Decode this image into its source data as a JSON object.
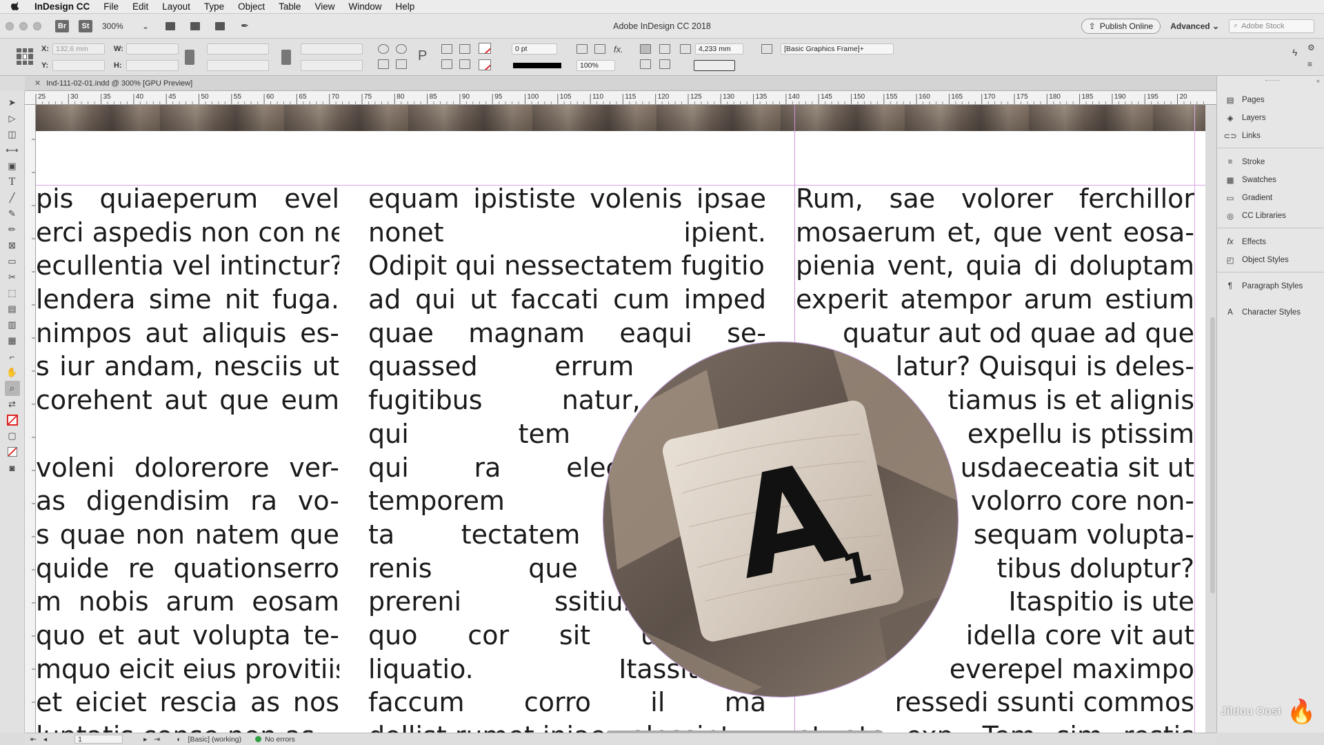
{
  "menubar": {
    "app": "InDesign CC",
    "items": [
      "File",
      "Edit",
      "Layout",
      "Type",
      "Object",
      "Table",
      "View",
      "Window",
      "Help"
    ]
  },
  "appbar": {
    "title": "Adobe InDesign CC 2018",
    "bridge_badge": "Br",
    "stock_badge": "St",
    "zoom": "300%",
    "publish_label": "Publish Online",
    "workspace": "Advanced",
    "search_placeholder": "Adobe Stock"
  },
  "control": {
    "x_label": "X:",
    "y_label": "Y:",
    "w_label": "W:",
    "h_label": "H:",
    "x_value": "132,6 mm",
    "stroke_weight": "0 pt",
    "opacity": "100%",
    "gutter": "4,233 mm",
    "object_style": "[Basic Graphics Frame]+"
  },
  "document_tab": {
    "label": "Ind-111-02-01.indd @ 300% [GPU Preview]"
  },
  "ruler": {
    "labels": [
      "25",
      "30",
      "35",
      "40",
      "45",
      "50",
      "55",
      "60",
      "65",
      "70",
      "75",
      "80",
      "85",
      "90",
      "95",
      "100",
      "105",
      "110",
      "115",
      "120",
      "125",
      "130",
      "135",
      "140",
      "145",
      "150",
      "155",
      "160",
      "165",
      "170",
      "175",
      "180",
      "185",
      "190",
      "195",
      "20"
    ]
  },
  "text": {
    "col1": [
      "pis quiaeperum evel",
      "erci aspedis non con ne",
      "ecullentia vel intinctur?",
      "lendera sime nit fuga.",
      "nimpos aut aliquis es-",
      "s iur andam, nesciis ut",
      "corehent aut que eum",
      "",
      "voleni dolorerore ver-",
      "as digendisim ra vo-",
      "s quae non natem que",
      "quide re quationserro",
      "m nobis arum eosam",
      "quo et aut volupta te-",
      "mquo eicit eius provitiis",
      "et eiciet rescia as nos",
      "luptatis conse non as"
    ],
    "col2": [
      "equam ipististe volenis ipsae",
      "nonet ipient.",
      "Odipit qui nessectatem fugitios",
      "ad qui ut faccati cum imped",
      "quae magnam eaqui se-",
      "quassed errum sam",
      "fugitibus natur, nos",
      "qui tem conse-",
      "qui ra elecea est,",
      "temporem illup-",
      "ta tectatem et et",
      "renis que veriate",
      "prereni ssitiur se-",
      "quo cor sit ut vel-",
      "liquatio. Itassitatum",
      "faccum corro il ma",
      "dollist rumet iniae volessint"
    ],
    "col3": [
      "Rum, sae volorer ferchillor",
      "mosaerum et, que vent eosa-",
      "pienia vent, quia di doluptam",
      "experit atempor arum estium",
      "quatur aut od quae ad que",
      "latur? Quisqui is deles-",
      "tiamus is et alignis",
      "expellu is ptissim",
      "usdaeceatia sit ut",
      "volorro core non-",
      "sequam volupta-",
      "tibus doluptur?",
      "Itaspitio is ute",
      "idella core vit aut",
      "everepel maximpo",
      "ressedi ssunti commos",
      "et ate exp. Tem sim restis"
    ]
  },
  "image": {
    "tile_letter": "A",
    "tile_score": "1"
  },
  "panels": [
    "Pages",
    "Layers",
    "Links",
    "Stroke",
    "Swatches",
    "Gradient",
    "CC Libraries",
    "Effects",
    "Object Styles",
    "Paragraph Styles",
    "Character Styles"
  ],
  "status": {
    "page": "1",
    "preflight_profile": "[Basic] (working)",
    "errors": "No errors"
  },
  "watermark": "Jildou Oost"
}
